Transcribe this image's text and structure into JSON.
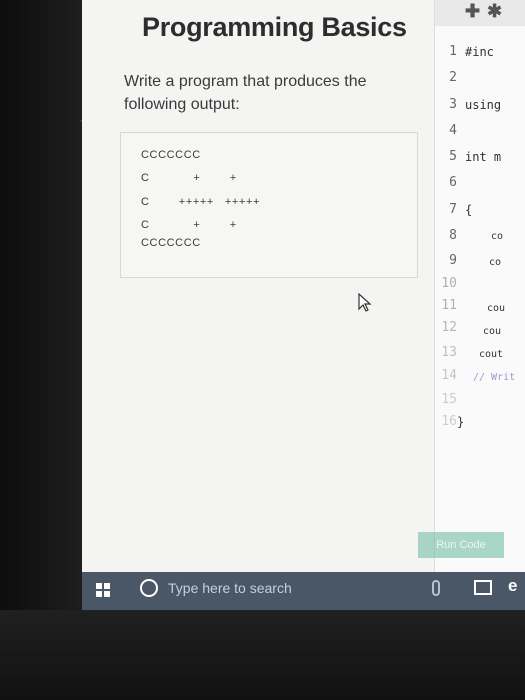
{
  "title": "Programming Basics",
  "prompt": "Write a program that produces the following output:",
  "output_lines": [
    "CCCCCCC",
    "C            +        +",
    "C        +++++   +++++",
    "C            +        +",
    "CCCCCCC"
  ],
  "editor": {
    "line_numbers": [
      "1",
      "2",
      "3",
      "4",
      "5",
      "6",
      "7",
      "8",
      "9",
      "10",
      "11",
      "12",
      "13",
      "14",
      "15",
      "16"
    ],
    "code": [
      "#inc",
      "",
      "using",
      "",
      "int m",
      "",
      "{",
      "co",
      "co",
      "",
      "cou",
      "cou",
      "cout",
      "// Writ",
      "",
      "}"
    ],
    "toolbar_icons": [
      "plus-icon",
      "gear-icon"
    ]
  },
  "run_button_label": "Run Code",
  "taskbar": {
    "search_placeholder": "Type here to search",
    "icons": [
      "windows-start-icon",
      "cortana-search-icon",
      "microphone-icon",
      "task-view-icon",
      "edge-icon"
    ]
  }
}
